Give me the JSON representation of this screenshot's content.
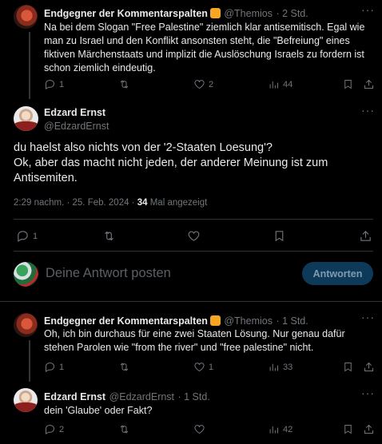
{
  "tweet1": {
    "name": "Endgegner der Kommentarspalten",
    "handle": "@Themios",
    "time": "· 2 Std.",
    "text": "Na bei dem Slogan \"Free Palestine\" ziemlich klar antisemitisch. Egal wie man zu Israel und den Konflikt ansonsten steht, die \"Befreiung\" eines fiktiven Märchenstaats und implizit die Auslöschung Israels zu fordern ist schon ziemlich eindeutig.",
    "replies": "1",
    "retweets": "",
    "likes": "2",
    "views": "44"
  },
  "main_tweet": {
    "name": "Edzard Ernst",
    "handle": "@EdzardErnst",
    "line1": "du haelst also nichts von der '2-Staaten Loesung'?",
    "line2": "Ok, aber das macht nicht jeden, der anderer Meinung ist zum Antisemiten.",
    "timestamp": "2:29 nachm. · 25. Feb. 2024 ·",
    "views_count": "34",
    "views_label": "Mal angezeigt",
    "replies": "1"
  },
  "compose": {
    "placeholder": "Deine Antwort posten",
    "button": "Antworten"
  },
  "tweet2": {
    "name": "Endgegner der Kommentarspalten",
    "handle": "@Themios",
    "time": "· 1 Std.",
    "text": "Oh, ich bin durchaus für eine zwei Staaten Lösung. Nur genau dafür stehen Parolen wie \"from the river\" und \"free palestine\" nicht.",
    "replies": "1",
    "likes": "1",
    "views": "33"
  },
  "tweet3": {
    "name": "Edzard Ernst",
    "handle": "@EdzardErnst",
    "time": "· 1 Std.",
    "text": "dein 'Glaube' oder Fakt?",
    "replies": "2",
    "views": "42"
  },
  "icons": {
    "reply": "reply-icon",
    "retweet": "retweet-icon",
    "like": "heart-icon",
    "views": "views-icon",
    "bookmark": "bookmark-icon",
    "share": "share-icon",
    "more": "more-icon"
  },
  "colors": {
    "background": "#000000",
    "text": "#e7e9ea",
    "muted": "#71767b",
    "accent_disabled": "#0e3a5a",
    "emoji": "#f5a623"
  }
}
